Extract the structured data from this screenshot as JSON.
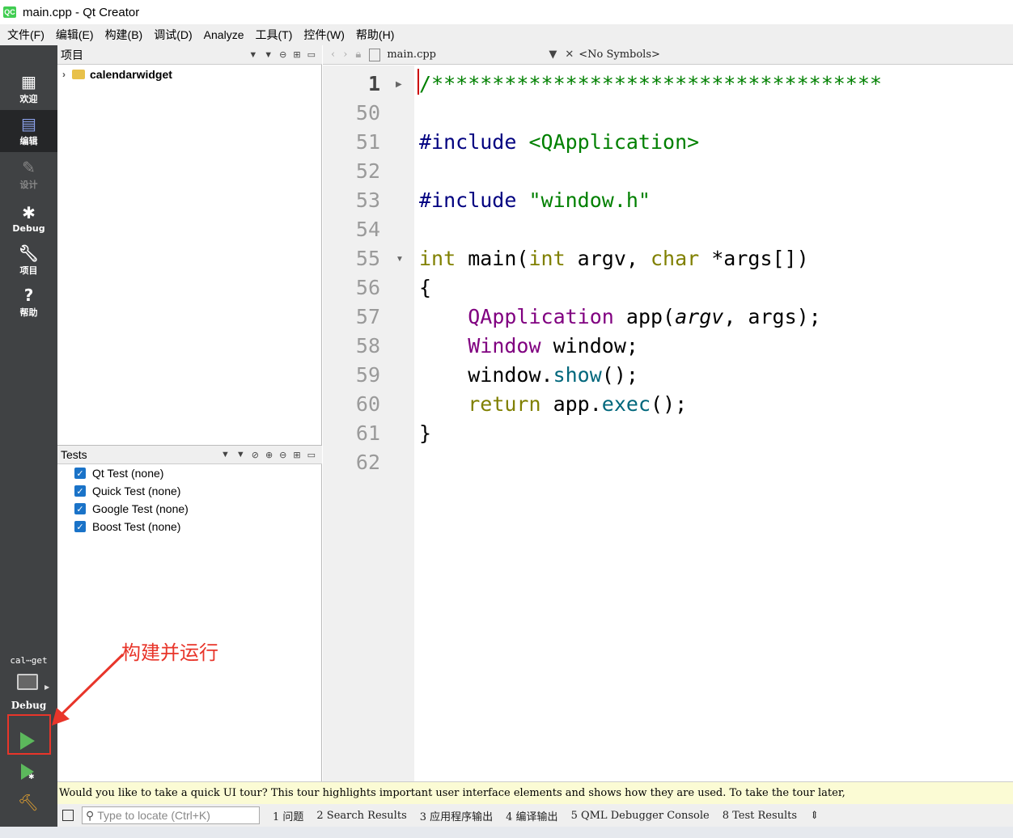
{
  "window": {
    "title": "main.cpp - Qt Creator",
    "logo": "QC"
  },
  "menu": [
    "文件(F)",
    "编辑(E)",
    "构建(B)",
    "调试(D)",
    "Analyze",
    "工具(T)",
    "控件(W)",
    "帮助(H)"
  ],
  "modes": [
    {
      "label": "欢迎",
      "icon": "grid-icon"
    },
    {
      "label": "编辑",
      "icon": "edit-doc-icon"
    },
    {
      "label": "设计",
      "icon": "pencil-icon"
    },
    {
      "label": "Debug",
      "icon": "bug-icon"
    },
    {
      "label": "项目",
      "icon": "wrench-icon"
    },
    {
      "label": "帮助",
      "icon": "help-icon"
    }
  ],
  "kit": {
    "project": "cal⋯get",
    "build_config": "Debug"
  },
  "projects_pane": {
    "title": "项目",
    "root": "calendarwidget"
  },
  "tests_pane": {
    "title": "Tests",
    "items": [
      "Qt Test (none)",
      "Quick Test (none)",
      "Google Test (none)",
      "Boost Test (none)"
    ]
  },
  "editor": {
    "file": "main.cpp",
    "symbols": "<No Symbols>",
    "lines": [
      {
        "n": "1",
        "cur": true
      },
      {
        "n": "50"
      },
      {
        "n": "51"
      },
      {
        "n": "52"
      },
      {
        "n": "53"
      },
      {
        "n": "54"
      },
      {
        "n": "55"
      },
      {
        "n": "56"
      },
      {
        "n": "57"
      },
      {
        "n": "58"
      },
      {
        "n": "59"
      },
      {
        "n": "60"
      },
      {
        "n": "61"
      },
      {
        "n": "62"
      }
    ],
    "code": {
      "l1": "/*************************************",
      "l51_a": "#include ",
      "l51_b": "<QApplication>",
      "l53_a": "#include ",
      "l53_b": "\"window.h\"",
      "l55_int1": "int",
      "l55_main": " main(",
      "l55_int2": "int",
      "l55_argv": " argv, ",
      "l55_char": "char",
      "l55_rest": " *args[])",
      "l56": "{",
      "l57_type": "QApplication",
      "l57_a": " app(",
      "l57_argv": "argv",
      "l57_b": ", args);",
      "l58_type": "Window",
      "l58_rest": " window;",
      "l59_a": "window.",
      "l59_fn": "show",
      "l59_b": "();",
      "l60_kw": "return",
      "l60_a": " app.",
      "l60_fn": "exec",
      "l60_b": "();",
      "l61": "}"
    }
  },
  "tour_message": "Would you like to take a quick UI tour? This tour highlights important user interface elements and shows how they are used. To take the tour later,",
  "locator_placeholder": "Type to locate (Ctrl+K)",
  "output_tabs": [
    "1 问题",
    "2 Search Results",
    "3 应用程序输出",
    "4 编译输出",
    "5 QML Debugger Console",
    "8 Test Results"
  ],
  "annotation": "构建并运行",
  "colors": {
    "mode_bar": "#404244",
    "highlight": "#e8352a",
    "run_green": "#5cb85c"
  }
}
